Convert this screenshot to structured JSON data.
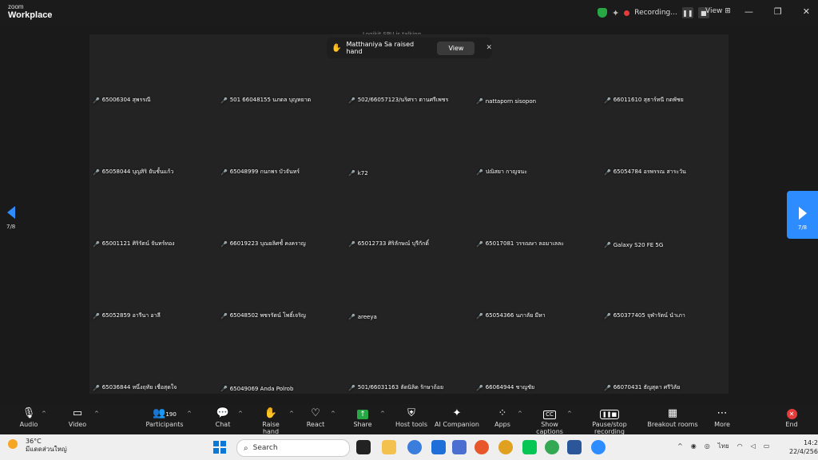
{
  "brand": {
    "line1": "zoom",
    "line2": "Workplace"
  },
  "recording": {
    "label": "Recording...",
    "view": "View"
  },
  "top_name": "Logikit SPU is talking",
  "banner": {
    "text": "Matthaniya Sa raised hand",
    "view": "View"
  },
  "pager": {
    "left": "7/8",
    "right": "7/8"
  },
  "participants": [
    "65006304 สุพรรณี",
    "501 66048155 นภดล บุญหยาด",
    "502/66057123/นริศรา ตานศรีเพชร",
    "nattaporn sisopon",
    "66011610 สุธาร์ทนี กดพัชย",
    "65058044 บุญสิริ ยันชั้นแก้ว",
    "65048999 กนกพร บัวจันทร์",
    "k72",
    "ปณิสยา กาญจนะ",
    "65054784 อรพรรณ สาระวัน",
    "65001121 ศิริรัตน์ จันทร์ทอง",
    "66019223 บุณยลิศชั้ คงคราญ",
    "65012733 ศิริลักษณ์ บุรีกักดิ์",
    "65017081 วรรณษา ลอมาเลละ",
    "Galaxy S20 FE 5G",
    "65052859 อารีนา อาลี",
    "65048502 พชรรัตน์ โพธิ์เจริญ",
    "areeya",
    "65054366 นภาลัย มีหา",
    "650377405 จุฬารัตน์ นำเภา",
    "65036844 หนึ่งฤทัย เชื่อสุดใจ",
    "65049069 Anda Polrob",
    "501/66031163 ลัดนิลิด รักษาถ้อย",
    "66064944 ชาญชัย",
    "66070431 ธัญสุดา ศรีวิลัย"
  ],
  "toolbar": {
    "audio": "Audio",
    "video": "Video",
    "participants": "Participants",
    "participant_count": "190",
    "chat": "Chat",
    "raise_hand": "Raise hand",
    "react": "React",
    "share": "Share",
    "host_tools": "Host tools",
    "ai_companion": "AI Companion",
    "apps": "Apps",
    "show_captions": "Show captions",
    "pause_stop_recording": "Pause/stop recording",
    "breakout_rooms": "Breakout rooms",
    "more": "More",
    "end": "End"
  },
  "taskbar": {
    "temp": "36°C",
    "weather": "มีแดดส่วนใหญ่",
    "search": "Search",
    "lang": "ไทย",
    "time": "14:23",
    "date": "22/4/2568"
  },
  "colors": {
    "accent": "#2d8cff",
    "mic_off": "#e53b3b",
    "raised_hand": "#f6c643"
  }
}
